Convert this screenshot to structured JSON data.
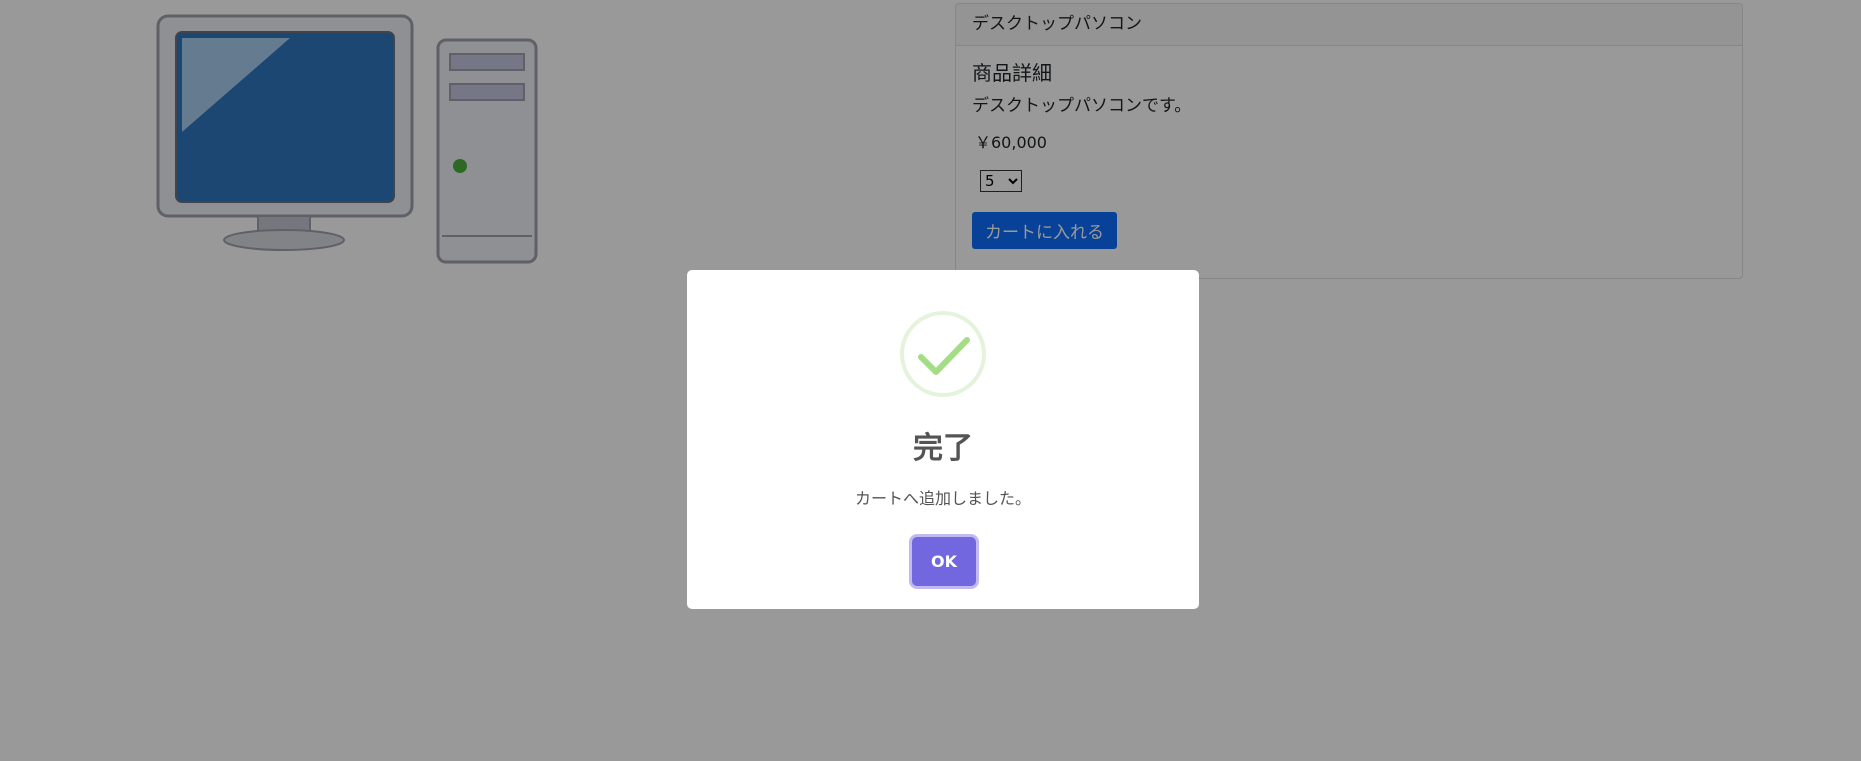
{
  "product": {
    "header": "デスクトップパソコン",
    "section_title": "商品詳細",
    "description": "デスクトップパソコンです。",
    "price": "￥60,000",
    "quantity_selected": "5",
    "add_to_cart_label": "カートに入れる"
  },
  "modal": {
    "title": "完了",
    "message": "カートへ追加しました。",
    "ok_label": "OK"
  },
  "colors": {
    "primary_button": "#0d6efd",
    "confirm_button": "#7367e0",
    "success_icon": "#a5dc86",
    "monitor_screen": "#2f77bf"
  },
  "icons": {
    "product_image": "desktop-computer-icon",
    "success": "check-circle-icon"
  }
}
